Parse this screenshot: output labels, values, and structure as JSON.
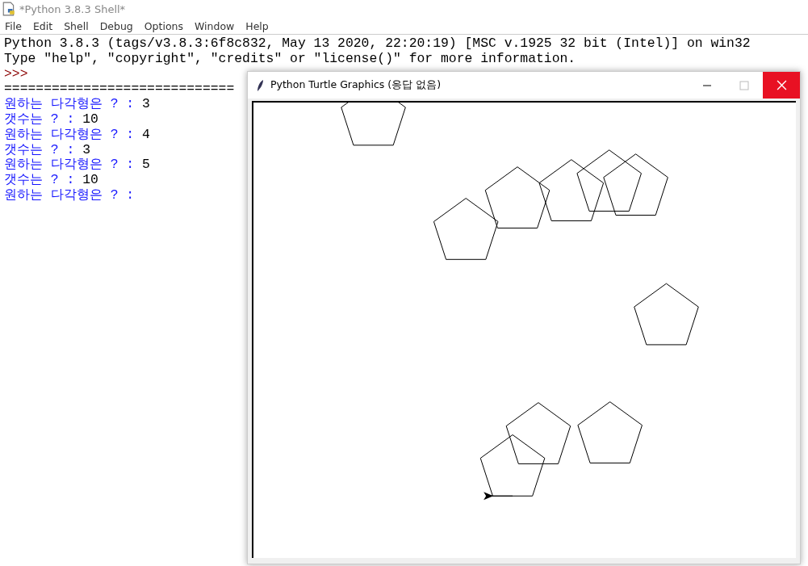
{
  "window": {
    "title": "*Python 3.8.3 Shell*"
  },
  "menu": [
    "File",
    "Edit",
    "Shell",
    "Debug",
    "Options",
    "Window",
    "Help"
  ],
  "shell": {
    "banner": [
      "Python 3.8.3 (tags/v3.8.3:6f8c832, May 13 2020, 22:20:19) [MSC v.1925 32 bit (Intel)] on win32",
      "Type \"help\", \"copyright\", \"credits\" or \"license()\" for more information."
    ],
    "prompt": ">>>",
    "separator": "=============================",
    "lines": [
      {
        "prompt": "원하는 다각형은 ? : ",
        "answer": "3"
      },
      {
        "prompt": "갯수는 ? : ",
        "answer": "10"
      },
      {
        "prompt": "원하는 다각형은 ? : ",
        "answer": "4"
      },
      {
        "prompt": "갯수는 ? : ",
        "answer": "3"
      },
      {
        "prompt": "원하는 다각형은 ? : ",
        "answer": "5"
      },
      {
        "prompt": "갯수는 ? : ",
        "answer": "10"
      },
      {
        "prompt": "원하는 다각형은 ? : "
      }
    ]
  },
  "turtle_window": {
    "title": "Python Turtle Graphics (응답 없음)"
  }
}
